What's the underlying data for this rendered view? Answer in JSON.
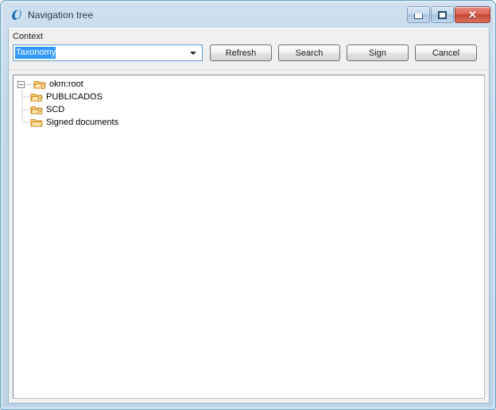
{
  "window": {
    "title": "Navigation tree",
    "app_icon": "openkm-logo-icon",
    "controls": {
      "minimize": "minimize-icon",
      "maximize": "maximize-icon",
      "close": "✕"
    },
    "colors": {
      "titlebar": "#c3d7ea",
      "frame_border": "#6fa8c8",
      "client_bg": "#f0f0f0",
      "tree_bg": "#ffffff",
      "selection": "#3399ff",
      "folder": "#f0a830",
      "close_button": "#c64632"
    }
  },
  "toolbar": {
    "context_label": "Context",
    "context_combo": {
      "value": "Taxonomy",
      "placeholder": "Taxonomy",
      "caret_icon": "chevron-down-icon",
      "options": [
        "Taxonomy"
      ]
    },
    "buttons": [
      {
        "label": "Refresh",
        "name": "refresh-button"
      },
      {
        "label": "Search",
        "name": "search-button"
      },
      {
        "label": "Sign",
        "name": "sign-button"
      },
      {
        "label": "Cancel",
        "name": "cancel-button"
      }
    ]
  },
  "tree": {
    "root": {
      "label": "okm:root",
      "expanded": true,
      "icon": "folder-locked-icon"
    },
    "children": [
      {
        "label": "PUBLICADOS",
        "icon": "folder-locked-icon"
      },
      {
        "label": "SCD",
        "icon": "folder-locked-icon"
      },
      {
        "label": "Signed documents",
        "icon": "folder-open-icon"
      }
    ]
  }
}
